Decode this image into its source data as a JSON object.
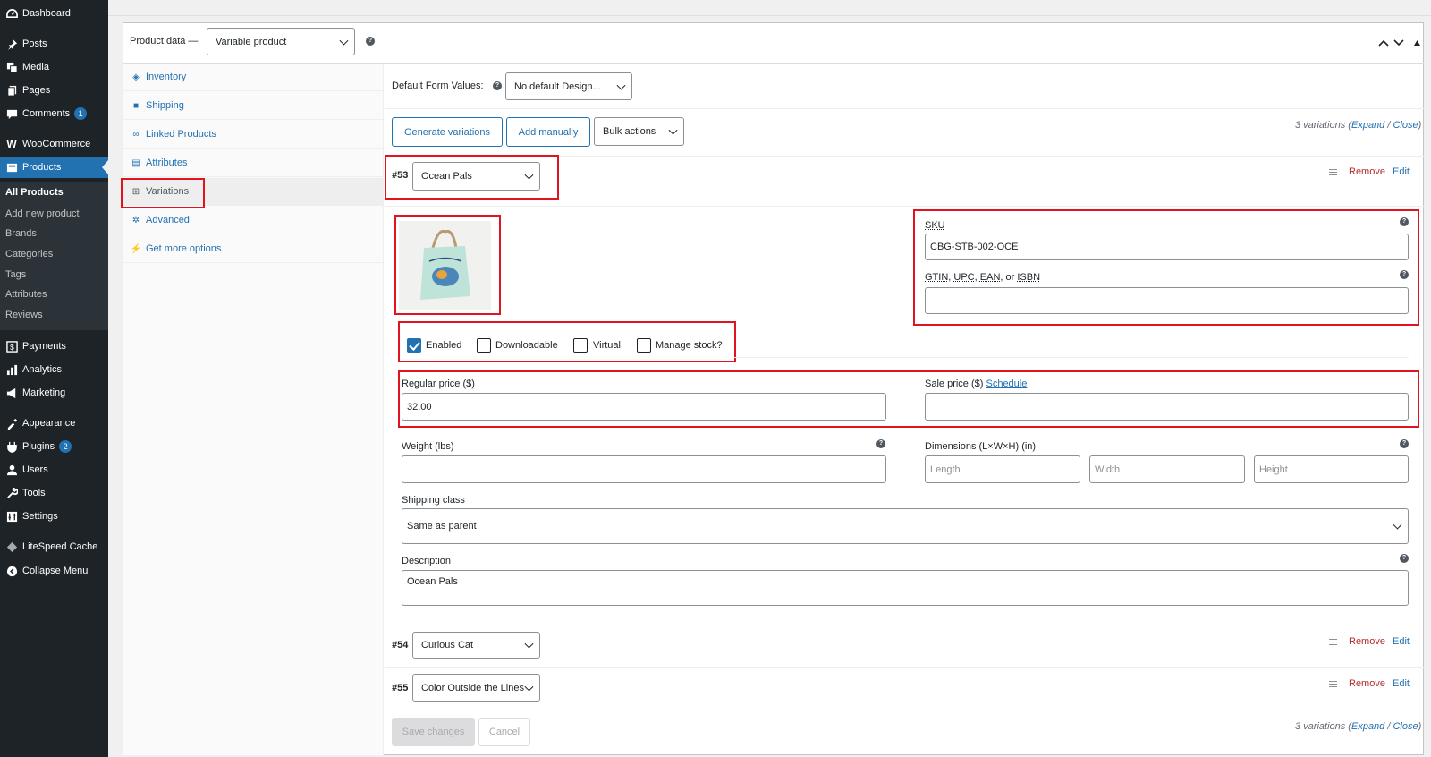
{
  "sidebar": {
    "items": [
      {
        "label": "Dashboard",
        "icon": "dashboard-icon"
      },
      {
        "label": "Posts",
        "icon": "pin-icon"
      },
      {
        "label": "Media",
        "icon": "media-icon"
      },
      {
        "label": "Pages",
        "icon": "pages-icon"
      },
      {
        "label": "Comments",
        "icon": "comment-icon",
        "badge": "1"
      },
      {
        "label": "WooCommerce",
        "icon": "woocommerce-icon"
      },
      {
        "label": "Products",
        "icon": "products-icon"
      },
      {
        "label": "Payments",
        "icon": "payments-icon"
      },
      {
        "label": "Analytics",
        "icon": "analytics-icon"
      },
      {
        "label": "Marketing",
        "icon": "marketing-icon"
      },
      {
        "label": "Appearance",
        "icon": "appearance-icon"
      },
      {
        "label": "Plugins",
        "icon": "plugins-icon",
        "badge": "2"
      },
      {
        "label": "Users",
        "icon": "users-icon"
      },
      {
        "label": "Tools",
        "icon": "tools-icon"
      },
      {
        "label": "Settings",
        "icon": "settings-icon"
      },
      {
        "label": "LiteSpeed Cache",
        "icon": "litespeed-icon"
      },
      {
        "label": "Collapse Menu",
        "icon": "collapse-icon"
      }
    ],
    "submenu": [
      "All Products",
      "Add new product",
      "Brands",
      "Categories",
      "Tags",
      "Attributes",
      "Reviews"
    ]
  },
  "product_data": {
    "label": "Product data —",
    "type_value": "Variable product"
  },
  "tabs": [
    "Inventory",
    "Shipping",
    "Linked Products",
    "Attributes",
    "Variations",
    "Advanced",
    "Get more options"
  ],
  "variations": {
    "default_form_label": "Default Form Values:",
    "default_form_value": "No default Design...",
    "generate_label": "Generate variations",
    "add_manually_label": "Add manually",
    "bulk_actions_label": "Bulk actions",
    "count_text": "3 variations (",
    "expand_label": "Expand",
    "sep": " / ",
    "close_label": "Close",
    "close_paren": ")",
    "remove_label": "Remove",
    "edit_label": "Edit",
    "items": [
      {
        "id": "#53",
        "name": "Ocean Pals"
      },
      {
        "id": "#54",
        "name": "Curious Cat"
      },
      {
        "id": "#55",
        "name": "Color Outside the Lines"
      }
    ],
    "detail": {
      "sku_label": "SKU",
      "sku_value": "CBG-STB-002-OCE",
      "gtin_label_parts": [
        "GTIN",
        ", ",
        "UPC",
        ", ",
        "EAN",
        ", or ",
        "ISBN"
      ],
      "gtin_value": "",
      "enabled_label": "Enabled",
      "downloadable_label": "Downloadable",
      "virtual_label": "Virtual",
      "manage_stock_label": "Manage stock?",
      "enabled_checked": true,
      "regular_price_label": "Regular price ($)",
      "regular_price_value": "32.00",
      "sale_price_label": "Sale price ($)",
      "schedule_label": "Schedule",
      "sale_price_value": "",
      "weight_label": "Weight (lbs)",
      "weight_value": "",
      "dimensions_label": "Dimensions (L×W×H) (in)",
      "length_placeholder": "Length",
      "width_placeholder": "Width",
      "height_placeholder": "Height",
      "shipping_class_label": "Shipping class",
      "shipping_class_value": "Same as parent",
      "description_label": "Description",
      "description_value": "Ocean Pals"
    },
    "save_label": "Save changes",
    "cancel_label": "Cancel"
  },
  "colors": {
    "accent": "#2271b1",
    "highlight": "#e0141e",
    "sidebar": "#1d2327",
    "remove": "#b32d2e"
  }
}
